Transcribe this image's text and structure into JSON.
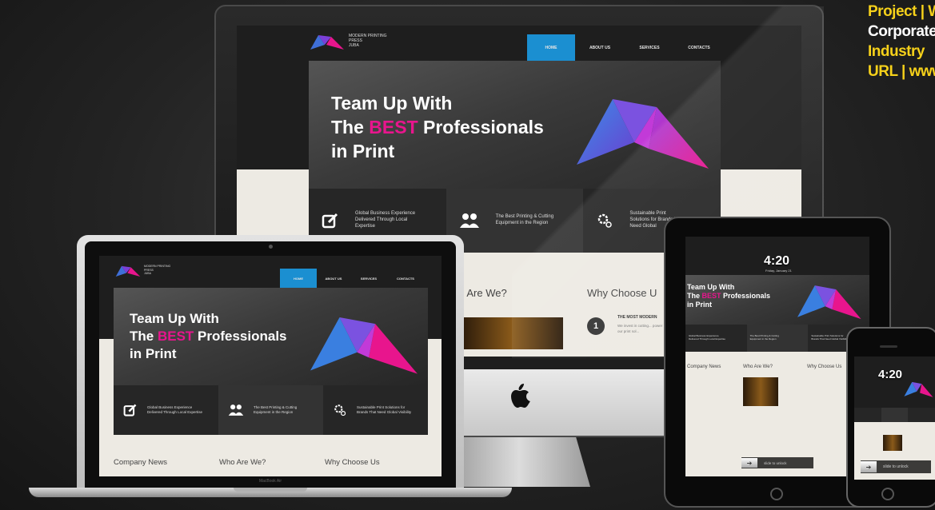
{
  "caption": {
    "line1_label": "Project",
    "line1_value": "| W",
    "line2": "Corporate",
    "line3": "Industry",
    "line4": "URL | www"
  },
  "site": {
    "company_name": "MODERN PRINTING\nPRESS\nJUBA",
    "nav": [
      "HOME",
      "ABOUT US",
      "SERVICES",
      "CONTACTS"
    ],
    "hero_line1": "Team Up With",
    "hero_line2_pre": "The ",
    "hero_line2_best": "BEST",
    "hero_line2_post": " Professionals",
    "hero_line3": "in Print",
    "features": [
      "Global Business Experience Delivered Through Local Expertise",
      "The Best Printing & Cutting Equipment in the Region",
      "Sustainable Print Solutions for Brands That Need Global Visibility"
    ],
    "imac_feature_1": "Global Business Experience Delivered Through Local Expertise",
    "imac_feature_3": "Sustainable Print Solutions for Brands That Need Global",
    "sections": [
      "Company News",
      "Who Are We?",
      "Why Choose Us"
    ],
    "imac_section_who": "ho Are We?",
    "imac_section_why": "Why Choose U",
    "imac_item_number": "1",
    "imac_item_title": "THE MOST MODERN",
    "imac_item_text": "We invest in cutting... power our print sol...",
    "accent": "#1b8fd1",
    "brand_pink": "#e8158d"
  },
  "devices": {
    "macbook_label": "MacBook Air",
    "ipad_time": "4:20",
    "ipad_date": "Friday, January 21",
    "ipad_slide": "slide to unlock",
    "iphone_time": "4:20",
    "iphone_slide": "slide to unlock"
  },
  "icons": {
    "edit": "edit-icon",
    "people": "people-icon",
    "gear": "gear-icon",
    "apple": "apple-logo-icon",
    "arrow": "arrow-right-icon"
  }
}
